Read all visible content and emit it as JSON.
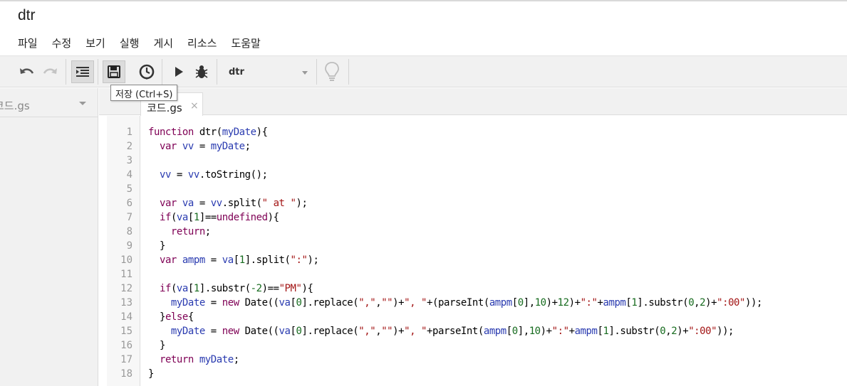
{
  "app": {
    "title": "dtr"
  },
  "menu": [
    "파일",
    "수정",
    "보기",
    "실행",
    "게시",
    "리소스",
    "도움말"
  ],
  "toolbar": {
    "function_select": "dtr",
    "tooltip": "저장 (Ctrl+S)"
  },
  "sidebar": {
    "file": "코드.gs"
  },
  "tab": {
    "label": "코드.gs",
    "close": "×"
  },
  "colors": {
    "keyword": "#7f0055",
    "variable": "#2a3bb0",
    "string": "#a31515",
    "number": "#166b1e"
  },
  "code": {
    "line_numbers": [
      "1",
      "2",
      "3",
      "4",
      "5",
      "6",
      "7",
      "8",
      "9",
      "10",
      "11",
      "12",
      "13",
      "14",
      "15",
      "16",
      "17",
      "18"
    ],
    "lines": [
      [
        [
          "k",
          "function"
        ],
        [
          "p",
          " dtr("
        ],
        [
          "v",
          "myDate"
        ],
        [
          "p",
          "){"
        ]
      ],
      [
        [
          "p",
          "  "
        ],
        [
          "k",
          "var"
        ],
        [
          "v",
          " vv"
        ],
        [
          "p",
          " = "
        ],
        [
          "v",
          "myDate"
        ],
        [
          "p",
          ";"
        ]
      ],
      [],
      [
        [
          "p",
          "  "
        ],
        [
          "v",
          "vv"
        ],
        [
          "p",
          " = "
        ],
        [
          "v",
          "vv"
        ],
        [
          "p",
          ".toString();"
        ]
      ],
      [],
      [
        [
          "p",
          "  "
        ],
        [
          "k",
          "var"
        ],
        [
          "v",
          " va"
        ],
        [
          "p",
          " = "
        ],
        [
          "v",
          "vv"
        ],
        [
          "p",
          ".split("
        ],
        [
          "s",
          "\" at \""
        ],
        [
          "p",
          ");"
        ]
      ],
      [
        [
          "p",
          "  "
        ],
        [
          "k",
          "if"
        ],
        [
          "p",
          "("
        ],
        [
          "v",
          "va"
        ],
        [
          "p",
          "["
        ],
        [
          "n",
          "1"
        ],
        [
          "p",
          "]=="
        ],
        [
          "k",
          "undefined"
        ],
        [
          "p",
          "){"
        ]
      ],
      [
        [
          "p",
          "    "
        ],
        [
          "k",
          "return"
        ],
        [
          "p",
          ";"
        ]
      ],
      [
        [
          "p",
          "  }"
        ]
      ],
      [
        [
          "p",
          "  "
        ],
        [
          "k",
          "var"
        ],
        [
          "v",
          " ampm"
        ],
        [
          "p",
          " = "
        ],
        [
          "v",
          "va"
        ],
        [
          "p",
          "["
        ],
        [
          "n",
          "1"
        ],
        [
          "p",
          "].split("
        ],
        [
          "s",
          "\":\""
        ],
        [
          "p",
          ");"
        ]
      ],
      [],
      [
        [
          "p",
          "  "
        ],
        [
          "k",
          "if"
        ],
        [
          "p",
          "("
        ],
        [
          "v",
          "va"
        ],
        [
          "p",
          "["
        ],
        [
          "n",
          "1"
        ],
        [
          "p",
          "].substr("
        ],
        [
          "n",
          "-2"
        ],
        [
          "p",
          ")=="
        ],
        [
          "s",
          "\"PM\""
        ],
        [
          "p",
          "){"
        ]
      ],
      [
        [
          "p",
          "    "
        ],
        [
          "v",
          "myDate"
        ],
        [
          "p",
          " = "
        ],
        [
          "k",
          "new"
        ],
        [
          "p",
          " Date(("
        ],
        [
          "v",
          "va"
        ],
        [
          "p",
          "["
        ],
        [
          "n",
          "0"
        ],
        [
          "p",
          "].replace("
        ],
        [
          "s",
          "\",\""
        ],
        [
          "p",
          ","
        ],
        [
          "s",
          "\"\""
        ],
        [
          "p",
          ")+"
        ],
        [
          "s",
          "\", \""
        ],
        [
          "p",
          "+(parseInt("
        ],
        [
          "v",
          "ampm"
        ],
        [
          "p",
          "["
        ],
        [
          "n",
          "0"
        ],
        [
          "p",
          "],"
        ],
        [
          "n",
          "10"
        ],
        [
          "p",
          ")+"
        ],
        [
          "n",
          "12"
        ],
        [
          "p",
          ")+"
        ],
        [
          "s",
          "\":\""
        ],
        [
          "p",
          "+"
        ],
        [
          "v",
          "ampm"
        ],
        [
          "p",
          "["
        ],
        [
          "n",
          "1"
        ],
        [
          "p",
          "].substr("
        ],
        [
          "n",
          "0"
        ],
        [
          "p",
          ","
        ],
        [
          "n",
          "2"
        ],
        [
          "p",
          ")+"
        ],
        [
          "s",
          "\":00\""
        ],
        [
          "p",
          "));"
        ]
      ],
      [
        [
          "p",
          "  }"
        ],
        [
          "k",
          "else"
        ],
        [
          "p",
          "{"
        ]
      ],
      [
        [
          "p",
          "    "
        ],
        [
          "v",
          "myDate"
        ],
        [
          "p",
          " = "
        ],
        [
          "k",
          "new"
        ],
        [
          "p",
          " Date(("
        ],
        [
          "v",
          "va"
        ],
        [
          "p",
          "["
        ],
        [
          "n",
          "0"
        ],
        [
          "p",
          "].replace("
        ],
        [
          "s",
          "\",\""
        ],
        [
          "p",
          ","
        ],
        [
          "s",
          "\"\""
        ],
        [
          "p",
          ")+"
        ],
        [
          "s",
          "\", \""
        ],
        [
          "p",
          "+parseInt("
        ],
        [
          "v",
          "ampm"
        ],
        [
          "p",
          "["
        ],
        [
          "n",
          "0"
        ],
        [
          "p",
          "],"
        ],
        [
          "n",
          "10"
        ],
        [
          "p",
          ")+"
        ],
        [
          "s",
          "\":\""
        ],
        [
          "p",
          "+"
        ],
        [
          "v",
          "ampm"
        ],
        [
          "p",
          "["
        ],
        [
          "n",
          "1"
        ],
        [
          "p",
          "].substr("
        ],
        [
          "n",
          "0"
        ],
        [
          "p",
          ","
        ],
        [
          "n",
          "2"
        ],
        [
          "p",
          ")+"
        ],
        [
          "s",
          "\":00\""
        ],
        [
          "p",
          "));"
        ]
      ],
      [
        [
          "p",
          "  }"
        ]
      ],
      [
        [
          "p",
          "  "
        ],
        [
          "k",
          "return"
        ],
        [
          "v",
          " myDate"
        ],
        [
          "p",
          ";"
        ]
      ],
      [
        [
          "p",
          "}"
        ]
      ]
    ]
  }
}
